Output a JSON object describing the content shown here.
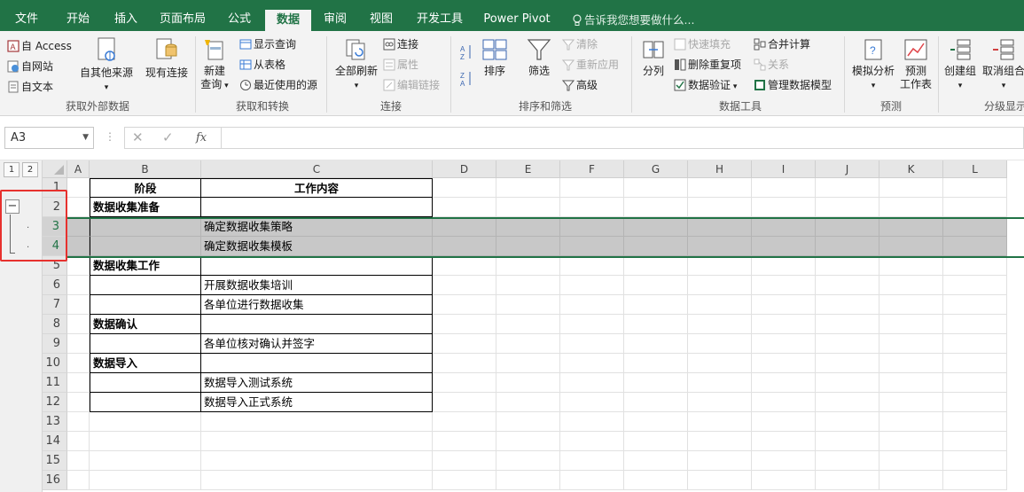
{
  "menu_tabs": [
    "文件",
    "开始",
    "插入",
    "页面布局",
    "公式",
    "数据",
    "审阅",
    "视图",
    "开发工具",
    "Power Pivot"
  ],
  "active_tab": "数据",
  "tell_me": "告诉我您想要做什么...",
  "ribbon": {
    "get_external": {
      "access": "自 Access",
      "web": "自网站",
      "text": "自文本",
      "other": "自其他来源",
      "existing": "现有连接",
      "label": "获取外部数据"
    },
    "get_transform": {
      "new_query_1": "新建",
      "new_query_2": "查询",
      "show_queries": "显示查询",
      "from_table": "从表格",
      "recent_sources": "最近使用的源",
      "label": "获取和转换"
    },
    "connections": {
      "refresh_all": "全部刷新",
      "connections": "连接",
      "properties": "属性",
      "edit_links": "编辑链接",
      "label": "连接"
    },
    "sort_filter": {
      "sort": "排序",
      "filter": "筛选",
      "clear": "清除",
      "reapply": "重新应用",
      "advanced": "高级",
      "label": "排序和筛选"
    },
    "data_tools": {
      "text_to_columns": "分列",
      "flash_fill": "快速填充",
      "remove_duplicates": "删除重复项",
      "data_validation": "数据验证",
      "consolidate": "合并计算",
      "relationships": "关系",
      "manage_model": "管理数据模型",
      "label": "数据工具"
    },
    "forecast": {
      "what_if": "模拟分析",
      "forecast_sheet_1": "预测",
      "forecast_sheet_2": "工作表",
      "label": "预测"
    },
    "outline": {
      "group": "创建组",
      "ungroup": "取消组合",
      "label": "分级显示"
    }
  },
  "formula_bar": {
    "name_box": "A3",
    "fx": "fx",
    "value": ""
  },
  "outline_levels": [
    "1",
    "2"
  ],
  "columns": [
    "A",
    "B",
    "C",
    "D",
    "E",
    "F",
    "G",
    "H",
    "I",
    "J",
    "K",
    "L"
  ],
  "rows": [
    "1",
    "2",
    "3",
    "4",
    "5",
    "6",
    "7",
    "8",
    "9",
    "10",
    "11",
    "12",
    "13",
    "14",
    "15",
    "16"
  ],
  "table": {
    "header_stage": "阶段",
    "header_content": "工作内容",
    "stages": [
      "数据收集准备",
      "数据收集工作",
      "数据确认",
      "数据导入"
    ],
    "tasks": [
      "确定数据收集策略",
      "确定数据收集模板",
      "开展数据收集培训",
      "各单位进行数据收集",
      "各单位核对确认并签字",
      "数据导入测试系统",
      "数据导入正式系统"
    ]
  },
  "colors": {
    "accent": "#217346",
    "highlight": "#e7312e",
    "shade": "#c8c8c8"
  }
}
